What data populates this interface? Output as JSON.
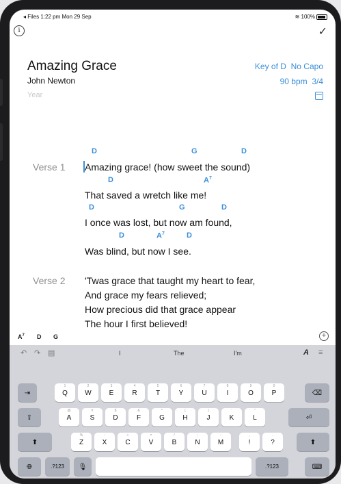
{
  "status": {
    "left": "◂ Files  1:22 pm  Mon 29 Sep",
    "right": "100%"
  },
  "song": {
    "title": "Amazing Grace",
    "author": "John Newton",
    "year_placeholder": "Year",
    "key": "Key of D",
    "capo": "No Capo",
    "bpm": "90 bpm",
    "time_sig": "3/4"
  },
  "verses": [
    {
      "label": "Verse 1",
      "lines": [
        {
          "text": "Amazing grace! (how sweet the sound)",
          "chords": [
            "D",
            "G",
            "D"
          ]
        },
        {
          "text": "That saved a wretch like me!",
          "chords": [
            "D",
            "A7"
          ]
        },
        {
          "text": "I once was lost, but now am found,",
          "chords": [
            "D",
            "G",
            "D"
          ]
        },
        {
          "text": "Was blind, but now I see.",
          "chords": [
            "D",
            "A7",
            "D"
          ]
        }
      ]
    },
    {
      "label": "Verse 2",
      "lines": [
        {
          "text": "'Twas grace that taught my heart to fear,"
        },
        {
          "text": "And grace my fears relieved;"
        },
        {
          "text": "How precious did that grace appear"
        },
        {
          "text": "The hour I first believed!"
        }
      ]
    }
  ],
  "chord_bar": [
    "A7",
    "D",
    "G"
  ],
  "keyboard": {
    "suggestions": [
      "I",
      "The",
      "I'm"
    ],
    "row1": [
      "Q",
      "W",
      "E",
      "R",
      "T",
      "Y",
      "U",
      "I",
      "O",
      "P"
    ],
    "row1_hints": [
      "1",
      "2",
      "3",
      "4",
      "5",
      "6",
      "7",
      "8",
      "9",
      "0"
    ],
    "row2": [
      "A",
      "S",
      "D",
      "F",
      "G",
      "H",
      "J",
      "K",
      "L"
    ],
    "row2_hints": [
      "@",
      "#",
      "$",
      "&",
      "*",
      "(",
      ")",
      "'",
      "\""
    ],
    "row3": [
      "Z",
      "X",
      "C",
      "V",
      "B",
      "N",
      "M",
      "!",
      "?"
    ],
    "row3_hints": [
      "%",
      "-",
      "+",
      "=",
      "/",
      ";",
      ":",
      ",",
      "."
    ],
    "numbers_label": ".?123"
  }
}
